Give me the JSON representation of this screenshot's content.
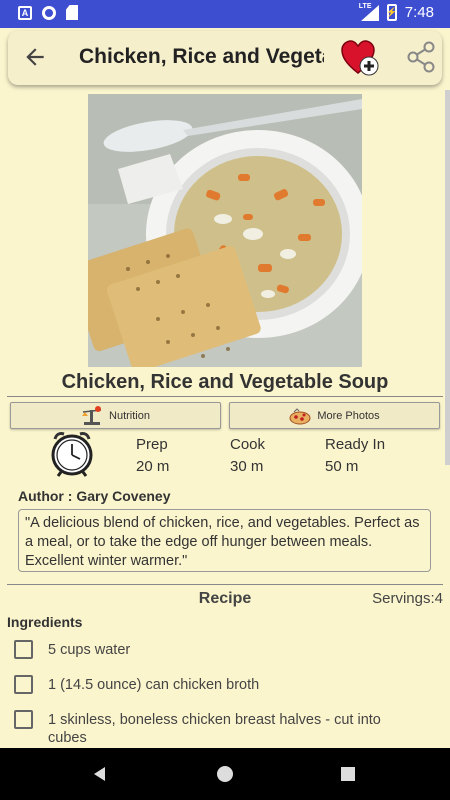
{
  "status_bar": {
    "time": "7:48",
    "network": "LTE",
    "icons": [
      "a-notification-icon",
      "circle-notification-icon",
      "sd-card-icon",
      "signal-icon",
      "battery-charging-icon"
    ]
  },
  "toolbar": {
    "title": "Chicken, Rice and Vegetable Soup",
    "back_icon": "arrow-back-icon",
    "favorite_icon": "heart-add-icon",
    "share_icon": "share-icon"
  },
  "recipe": {
    "title": "Chicken, Rice and Vegetable Soup",
    "tabs": [
      {
        "label": "Nutrition",
        "icon": "scale-icon"
      },
      {
        "label": "More Photos",
        "icon": "pizza-icon"
      }
    ],
    "times": {
      "prep_label": "Prep",
      "prep_value": "20 m",
      "cook_label": "Cook",
      "cook_value": "30 m",
      "ready_label": "Ready In",
      "ready_value": "50 m"
    },
    "author": "Author : Gary Coveney",
    "description": "\"A delicious blend of chicken, rice, and vegetables. Perfect as a meal, or to take the edge off hunger between meals. Excellent winter warmer.\"",
    "section_heading": "Recipe",
    "servings": "Servings:4",
    "ingredients_label": "Ingredients",
    "ingredients": [
      {
        "text": "5 cups water",
        "checked": false
      },
      {
        "text": "1 (14.5 ounce) can chicken broth",
        "checked": false
      },
      {
        "text": "1 skinless, boneless chicken breast halves - cut into cubes",
        "checked": false
      }
    ]
  },
  "colors": {
    "status_bar": "#3D4ED1",
    "background": "#FBF5CE",
    "heart": "#D8122A"
  }
}
